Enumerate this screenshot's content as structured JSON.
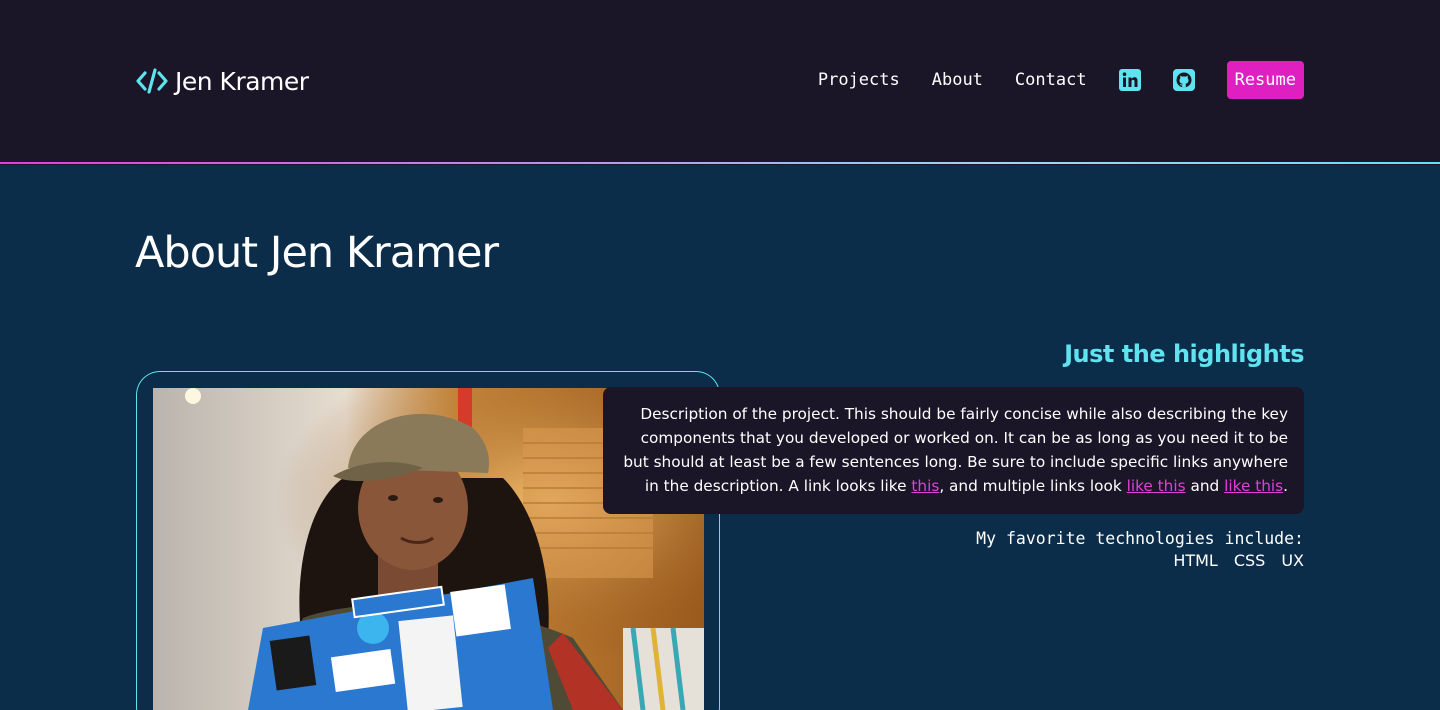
{
  "header": {
    "brand": {
      "icon": "code-icon",
      "name": "Jen Kramer"
    },
    "nav": [
      {
        "label": "Projects"
      },
      {
        "label": "About"
      },
      {
        "label": "Contact"
      }
    ],
    "social": [
      {
        "icon": "linkedin-icon"
      },
      {
        "icon": "github-icon"
      }
    ],
    "resume_label": "Resume"
  },
  "main": {
    "title": "About Jen Kramer",
    "photo": {
      "description_icon": "photo-person-with-laptop"
    },
    "highlights": {
      "heading": "Just the highlights",
      "description_text": "Description of the project. This should be fairly concise while also describing the key components that you developed or worked on. It can be as long as you need it to be but should at least be a few sentences long. Be sure to include specific links anywhere in the description. A link looks like",
      "link1": "this",
      "mid1": ", and multiple links look",
      "link2": "like this",
      "mid2": "and",
      "link3": "like this",
      "end": "."
    },
    "technologies": {
      "label": "My favorite technologies include:",
      "items": [
        "HTML",
        "CSS",
        "UX"
      ]
    }
  },
  "colors": {
    "header_bg": "#1a1628",
    "page_bg": "#0b2d4a",
    "accent_cyan": "#5fe3ee",
    "accent_magenta": "#e01fc1"
  }
}
